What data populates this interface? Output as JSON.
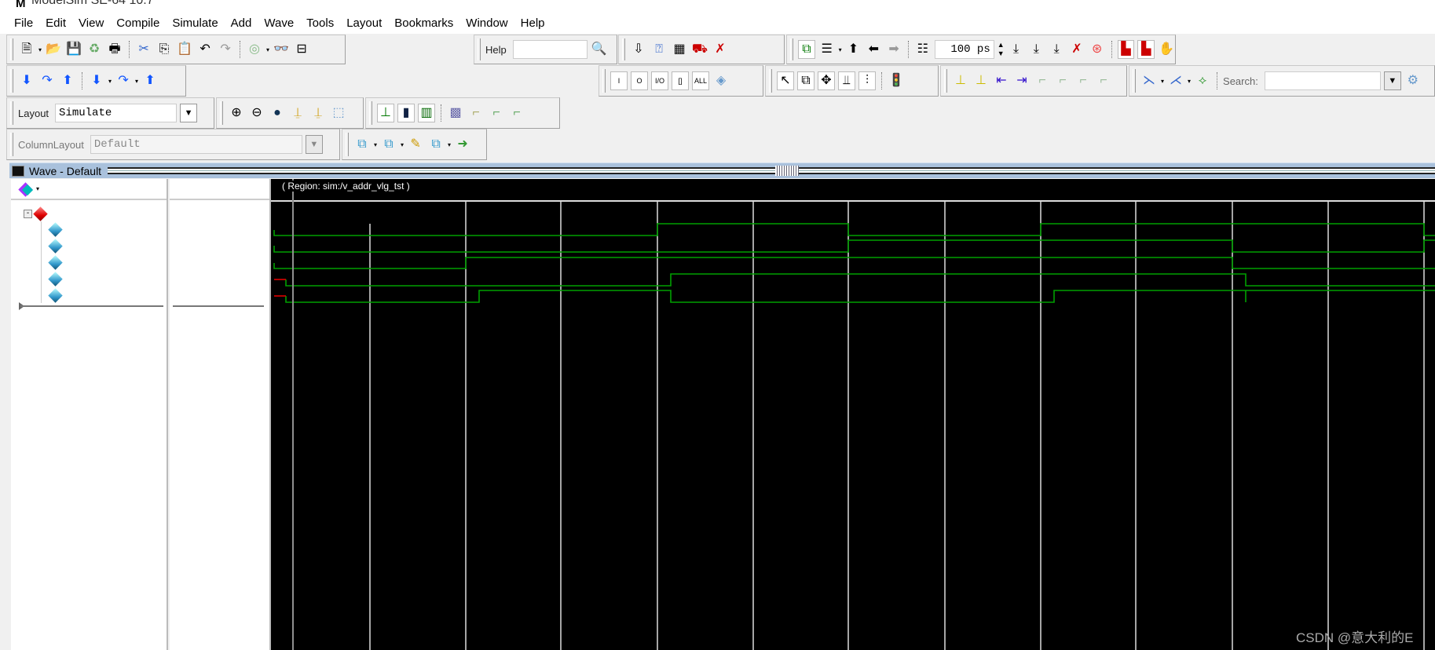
{
  "window": {
    "title": "ModelSim SE-64 10.7",
    "app_icon": "modelsim-logo"
  },
  "menu": [
    "File",
    "Edit",
    "View",
    "Compile",
    "Simulate",
    "Add",
    "Wave",
    "Tools",
    "Layout",
    "Bookmarks",
    "Window",
    "Help"
  ],
  "toolbar": {
    "help_label": "Help",
    "help_value": "",
    "run_length": "100 ps",
    "layout_label": "Layout",
    "layout_value": "Simulate",
    "column_layout_label": "ColumnLayout",
    "column_layout_value": "Default",
    "search_label": "Search:",
    "search_value": "",
    "filter_buttons": [
      "I",
      "O",
      "I/O",
      "[]",
      "ALL"
    ]
  },
  "wave_window": {
    "title": "Wave - Default",
    "region_text": "( Region: sim:/v_addr_vlg_tst )"
  },
  "colors": {
    "signal": "#00a000",
    "undefined": "#e00000",
    "grid": "#ffffff",
    "cursor": "#909090",
    "wave_bg": "#000000"
  },
  "watermark": "CSDN @意大利的E"
}
